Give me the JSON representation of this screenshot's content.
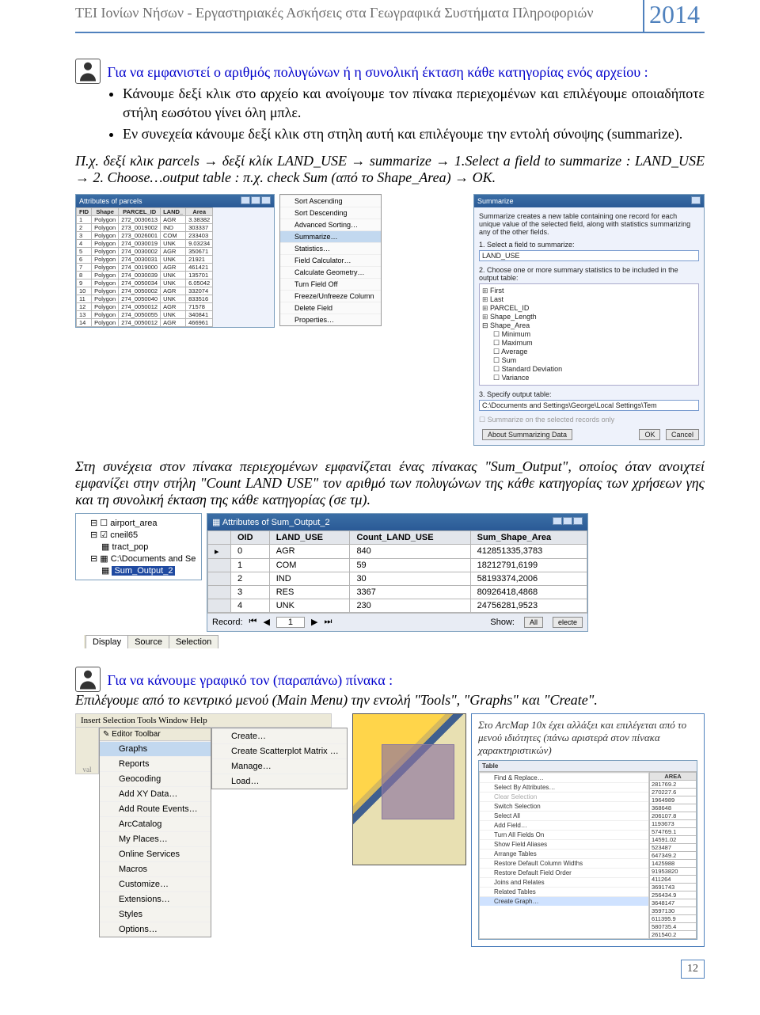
{
  "header": {
    "title": "ΤΕΙ Ιονίων Νήσων - Εργαστηριακές Ασκήσεις στα Γεωγραφικά Συστήματα Πληροφοριών",
    "year": "2014"
  },
  "intro": {
    "lead": "Για να εμφανιστεί ο αριθμός πολυγώνων ή η συνολική έκταση κάθε κατηγορίας ενός αρχείου :",
    "bullets": [
      "Κάνουμε δεξί κλικ στο αρχείο και ανοίγουμε τον πίνακα περιεχομένων και επιλέγουμε οποιαδήποτε στήλη εωσότου γίνει όλη μπλε.",
      "Εν συνεχεία κάνουμε δεξί κλικ στη στηλη αυτή και επιλέγουμε την εντολή σύνοψης (summarize)."
    ]
  },
  "example": {
    "text_a": "Π.χ. δεξί κλικ parcels ",
    "text_b": "δεξί κλίκ LAND_USE ",
    "text_c": "summarize ",
    "text_d": "1.Select a field to summarize : LAND_USE ",
    "text_e": "2. Choose…output table : π.χ. check Sum (από το Shape_Area) ",
    "text_f": "OK."
  },
  "fig1": {
    "parcels_title": "Attributes of parcels",
    "headers": [
      "FID",
      "Shape",
      "PARCEL_ID",
      "LAND_",
      "Area"
    ],
    "rows": [
      [
        "1",
        "Polygon",
        "272_0030613",
        "AGR",
        "3.38382"
      ],
      [
        "2",
        "Polygon",
        "273_0019002",
        "IND",
        "303337"
      ],
      [
        "3",
        "Polygon",
        "273_0026001",
        "COM",
        "233403"
      ],
      [
        "4",
        "Polygon",
        "274_0030019",
        "UNK",
        "9.03234"
      ],
      [
        "5",
        "Polygon",
        "274_0030002",
        "AGR",
        "350671"
      ],
      [
        "6",
        "Polygon",
        "274_0030031",
        "UNK",
        "21921"
      ],
      [
        "7",
        "Polygon",
        "274_0019000",
        "AGR",
        "461421"
      ],
      [
        "8",
        "Polygon",
        "274_0030039",
        "UNK",
        "135701"
      ],
      [
        "9",
        "Polygon",
        "274_0050034",
        "UNK",
        "6.05042"
      ],
      [
        "10",
        "Polygon",
        "274_0050002",
        "AGR",
        "332074"
      ],
      [
        "11",
        "Polygon",
        "274_0050040",
        "UNK",
        "833516"
      ],
      [
        "12",
        "Polygon",
        "274_0050012",
        "AGR",
        "71578"
      ],
      [
        "13",
        "Polygon",
        "274_0050055",
        "UNK",
        "340841"
      ],
      [
        "14",
        "Polygon",
        "274_0050012",
        "AGR",
        "466961"
      ]
    ],
    "ctx": [
      "Sort Ascending",
      "Sort Descending",
      "Advanced Sorting…",
      "Summarize…",
      "Statistics…",
      "Field Calculator…",
      "Calculate Geometry…",
      "Turn Field Off",
      "Freeze/Unfreeze Column",
      "Delete Field",
      "Properties…"
    ],
    "summarize_title": "Summarize",
    "summarize_desc": "Summarize creates a new table containing one record for each unique value of the selected field, along with statistics summarizing any of the other fields.",
    "step1": "1.  Select a field to summarize:",
    "step1_val": "LAND_USE",
    "step2": "2.  Choose one or more summary statistics to be included in the output table:",
    "tree": [
      "First",
      "Last",
      "PARCEL_ID",
      "Shape_Length",
      "Shape_Area"
    ],
    "stats": [
      "Minimum",
      "Maximum",
      "Average",
      "Sum",
      "Standard Deviation",
      "Variance"
    ],
    "step3": "3.  Specify output table:",
    "step3_val": "C:\\Documents and Settings\\George\\Local Settings\\Tem",
    "sel_only": "Summarize on the selected records only",
    "about": "About Summarizing Data",
    "ok": "OK",
    "cancel": "Cancel"
  },
  "after1": "Στη συνέχεια στον πίνακα περιεχομένων εμφανίζεται ένας πίνακας \"Sum_Output\", οποίος όταν ανοιχτεί εμφανίζει στην στήλη \"Count LAND USE\" τον αριθμό των πολυγώνων της κάθε κατηγορίας των χρήσεων γης και τη συνολική έκταση της κάθε κατηγορίας (σε τμ).",
  "toc": {
    "items": [
      "airport_area",
      "cneil65",
      "tract_pop",
      "C:\\Documents and Se"
    ],
    "selected": "Sum_Output_2"
  },
  "attrib": {
    "title": "Attributes of Sum_Output_2",
    "headers": [
      "OID",
      "LAND_USE",
      "Count_LAND_USE",
      "Sum_Shape_Area"
    ],
    "rows": [
      [
        "0",
        "AGR",
        "840",
        "412851335,3783"
      ],
      [
        "1",
        "COM",
        "59",
        "18212791,6199"
      ],
      [
        "2",
        "IND",
        "30",
        "58193374,2006"
      ],
      [
        "3",
        "RES",
        "3367",
        "80926418,4868"
      ],
      [
        "4",
        "UNK",
        "230",
        "24756281,9523"
      ]
    ],
    "footer_record": "Record:",
    "footer_num": "1",
    "footer_show": "Show:",
    "footer_all": "All",
    "footer_sel": "electe",
    "tabs": [
      "Display",
      "Source",
      "Selection"
    ]
  },
  "graph": {
    "lead": "Για να κάνουμε γραφικό τον (παραπάνω) πίνακα :",
    "para": "Επιλέγουμε από το κεντρικό μενού (Main Menu) την εντολή \"Tools\", \"Graphs\" και \"Create\"."
  },
  "menubar": "Insert  Selection  Tools  Window  Help",
  "tools_menu": {
    "hdr": "Editor Toolbar",
    "items": [
      "Graphs",
      "Reports",
      "Geocoding",
      "Add XY Data…",
      "Add Route Events…",
      "ArcCatalog",
      "My Places…",
      "Online Services",
      "Macros",
      "Customize…",
      "Extensions…",
      "Styles",
      "Options…"
    ]
  },
  "submenu": {
    "items": [
      "Create…",
      "Create Scatterplot Matrix …",
      "Manage…",
      "Load…"
    ]
  },
  "side_note": {
    "text": "Στο ArcMap 10x έχει αλλάξει και επιλέγεται από το μενού ιδιότητες (πάνω αριστερά στον πίνακα χαρακτηριστικών)",
    "toolbar": "Table",
    "ctx": [
      "Find & Replace…",
      "Select By Attributes…",
      "Clear Selection",
      "Switch Selection",
      "Select All",
      "Add Field…",
      "Turn All Fields On",
      "Show Field Aliases",
      "Arrange Tables",
      "Restore Default Column Widths",
      "Restore Default Field Order",
      "Joins and Relates",
      "Related Tables",
      "Create Graph…"
    ],
    "hdr": "AREA",
    "vals": [
      "281769.2",
      "270227.6",
      "1964989",
      "368648",
      "206107.8",
      "1193673",
      "574769.1",
      "14591.02",
      "523487",
      "647349.2",
      "1425988",
      "91953820",
      "411264",
      "3691743",
      "256434.9",
      "3648147",
      "3597130",
      "611395.9",
      "580735.4",
      "261540.2"
    ]
  },
  "page_num": "12"
}
